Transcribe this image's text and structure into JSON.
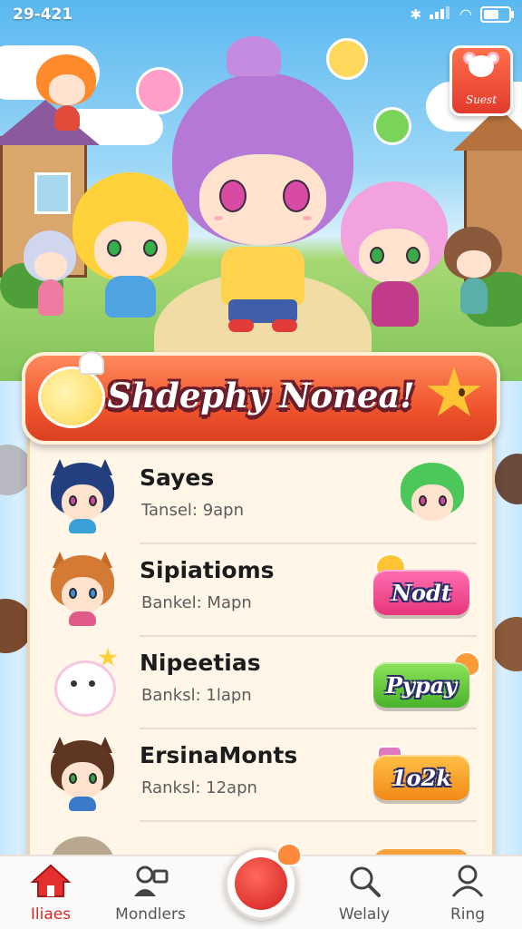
{
  "status_bar": {
    "time": "29-421",
    "icons": [
      "bluetooth-icon",
      "signal-icon",
      "wifi-icon",
      "battery-icon"
    ]
  },
  "quest_badge": {
    "label": "Suest",
    "icon": "mouse-icon"
  },
  "banner": {
    "title": "Shdephy Nonea!"
  },
  "list": [
    {
      "name": "Sayes",
      "subtitle": "Tansel: 9apn",
      "action_label": "",
      "action_type": "friend-avatar"
    },
    {
      "name": "Sipiatioms",
      "subtitle": "Bankel: Mapn",
      "action_label": "Nodt",
      "action_color": "#e7357c"
    },
    {
      "name": "Nipeetias",
      "subtitle": "Banksl: 1lapn",
      "action_label": "Pypay",
      "action_color": "#49b32b"
    },
    {
      "name": "ErsinaMonts",
      "subtitle": "Ranksl: 12apn",
      "action_label": "1o2k",
      "action_color": "#f28a17"
    }
  ],
  "nav": {
    "items": [
      {
        "label": "Iliaes",
        "icon": "home-icon",
        "active": true
      },
      {
        "label": "Mondlers",
        "icon": "members-icon",
        "active": false
      },
      {
        "label": "",
        "icon": "play-mascot-icon",
        "active": false
      },
      {
        "label": "Welaly",
        "icon": "search-icon",
        "active": false
      },
      {
        "label": "Ring",
        "icon": "profile-icon",
        "active": false
      }
    ]
  },
  "colors": {
    "accent_red": "#e23b2c",
    "banner_orange": "#f0552f",
    "panel_cream": "#fff6e8",
    "nav_active": "#d42a2a"
  }
}
